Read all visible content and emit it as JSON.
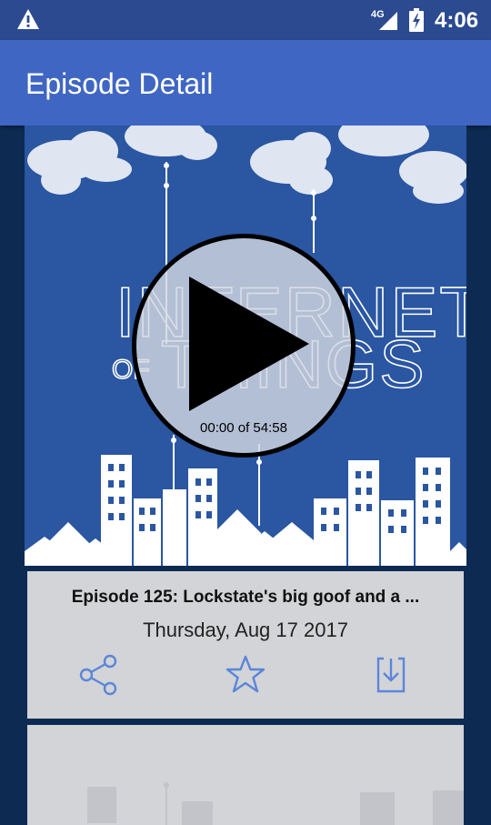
{
  "status_bar": {
    "network": "4G",
    "time": "4:06"
  },
  "app_bar": {
    "title": "Episode Detail"
  },
  "artwork": {
    "word_top": "INTERNET",
    "word_of": "OF",
    "word_bottom": "THINGS"
  },
  "player": {
    "time_label": "00:00 of 54:58"
  },
  "episode": {
    "title": "Episode 125: Lockstate's big goof and a ...",
    "date": "Thursday, Aug 17 2017"
  },
  "icons": {
    "warning": "warning-icon",
    "share": "share-icon",
    "star": "star-icon",
    "download": "download-icon",
    "play": "play-icon"
  },
  "colors": {
    "status_bar": "#2c4a8f",
    "app_bar": "#3f66c2",
    "artwork_bg": "#2a56a2",
    "card_bg": "#d3d4d8",
    "icon_blue": "#5c86d8"
  }
}
